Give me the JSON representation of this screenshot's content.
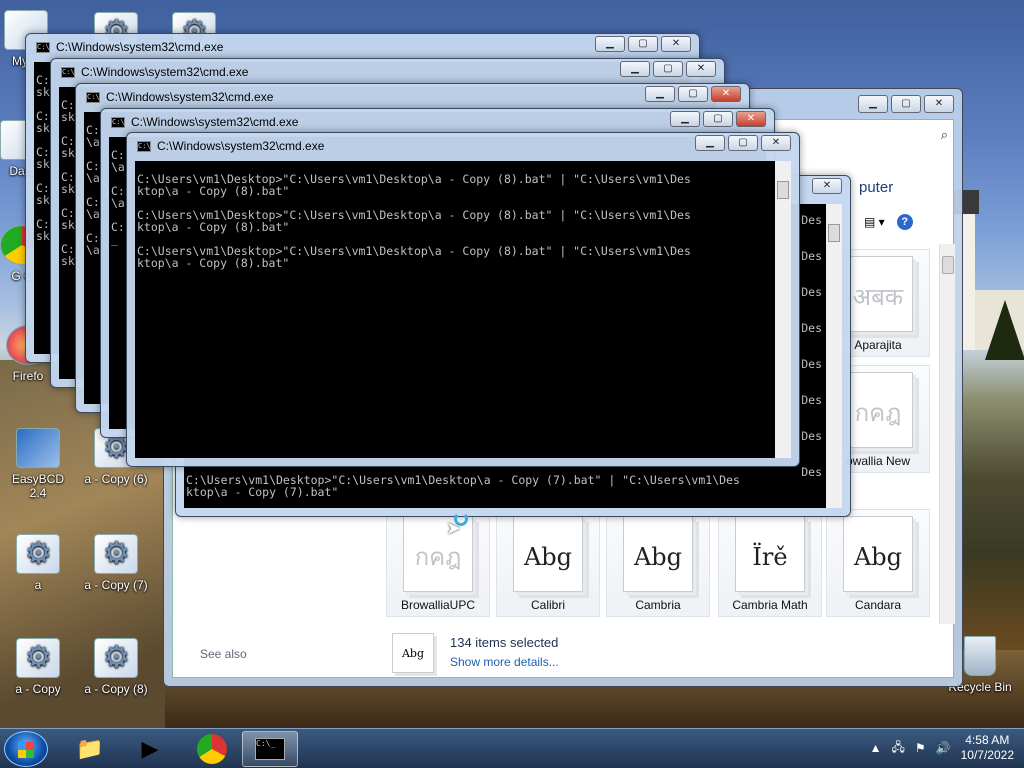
{
  "desktop": {
    "icons": [
      {
        "key": "my-computer",
        "label": "My C"
      },
      {
        "key": "data",
        "label": "Data"
      },
      {
        "key": "chrome-partial",
        "label": "G C"
      },
      {
        "key": "firefox",
        "label": "Firefo"
      },
      {
        "key": "easybcd",
        "label": "EasyBCD 2.4"
      },
      {
        "key": "a-copy-6",
        "label": "a - Copy (6)"
      },
      {
        "key": "a",
        "label": "a"
      },
      {
        "key": "a-copy-7",
        "label": "a - Copy (7)"
      },
      {
        "key": "a-copy",
        "label": "a - Copy"
      },
      {
        "key": "a-copy-8",
        "label": "a - Copy (8)"
      },
      {
        "key": "recycle-bin",
        "label": "Recycle Bin"
      }
    ]
  },
  "explorer": {
    "title_fragment": "puter",
    "fonts": [
      {
        "preview": "अबक",
        "name": "Aparajita",
        "faded": true
      },
      {
        "preview": "กคฎ",
        "name": "owallia New",
        "faded": true
      },
      {
        "preview": "กคฎ",
        "name": "BrowalliaUPC",
        "faded": true
      },
      {
        "preview": "Abg",
        "name": "Calibri",
        "faded": false
      },
      {
        "preview": "Abg",
        "name": "Cambria",
        "faded": false
      },
      {
        "preview": "Ïrě",
        "name": "Cambria Math",
        "faded": false
      },
      {
        "preview": "Abg",
        "name": "Candara",
        "faded": false
      }
    ],
    "see_also": "See also",
    "details": {
      "thumb": "Abg",
      "selected": "134 items selected",
      "more": "Show more details..."
    }
  },
  "cmd": {
    "title": "C:\\Windows\\system32\\cmd.exe",
    "front_output": "C:\\Users\\vm1\\Desktop>\"C:\\Users\\vm1\\Desktop\\a - Copy (8).bat\" | \"C:\\Users\\vm1\\Des\nktop\\a - Copy (8).bat\"\n\nC:\\Users\\vm1\\Desktop>\"C:\\Users\\vm1\\Desktop\\a - Copy (8).bat\" | \"C:\\Users\\vm1\\Des\nktop\\a - Copy (8).bat\"\n\nC:\\Users\\vm1\\Desktop>\"C:\\Users\\vm1\\Desktop\\a - Copy (8).bat\" | \"C:\\Users\\vm1\\Des\nktop\\a - Copy (8).bat\"",
    "lower_output": "C:\\Users\\vm1\\Desktop>\"C:\\Users\\vm1\\Desktop\\a - Copy (7).bat\" | \"C:\\Users\\vm1\\Des\nktop\\a - Copy (7).bat\"",
    "bg_fragments": {
      "w1": "C:\nsk\n\nC:\nsk\n\nC:\nsk\n\nC:\nsk\n\nC:\nsk",
      "w2": "C:\nsk\n\nC:\nsk\n\nC:\nsk\n\nC:\nsk\n\nC:\nsk",
      "w3": "C:\n\\a\n\nC:\n\\a\n\nC:\n\\a\n\nC:\n\\a",
      "w4": "C:\n\\a\n\nC:\n\\a\n\nC:\n_",
      "right": "Des\n\n\nDes\n\n\nDes\n\n\nDes\n\n\nDes\n\n\nDes\n\n\nDes\n\n\nDes"
    }
  },
  "taskbar": {
    "time": "4:58 AM",
    "date": "10/7/2022"
  }
}
